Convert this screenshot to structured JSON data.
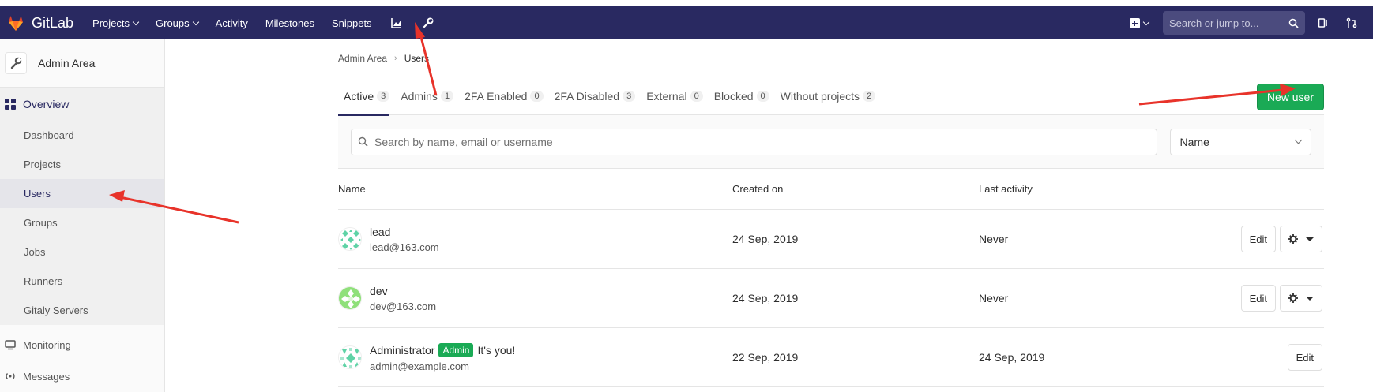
{
  "navbar": {
    "brand": "GitLab",
    "links": [
      {
        "label": "Projects",
        "dropdown": true
      },
      {
        "label": "Groups",
        "dropdown": true
      },
      {
        "label": "Activity",
        "dropdown": false
      },
      {
        "label": "Milestones",
        "dropdown": false
      },
      {
        "label": "Snippets",
        "dropdown": false
      }
    ],
    "search_placeholder": "Search or jump to...",
    "bg_color": "#292961"
  },
  "sidebar": {
    "title": "Admin Area",
    "overview_label": "Overview",
    "items": [
      {
        "label": "Dashboard",
        "active": false
      },
      {
        "label": "Projects",
        "active": false
      },
      {
        "label": "Users",
        "active": true
      },
      {
        "label": "Groups",
        "active": false
      },
      {
        "label": "Jobs",
        "active": false
      },
      {
        "label": "Runners",
        "active": false
      },
      {
        "label": "Gitaly Servers",
        "active": false
      }
    ],
    "monitoring_label": "Monitoring",
    "messages_label": "Messages"
  },
  "breadcrumb": {
    "parent": "Admin Area",
    "current": "Users"
  },
  "tabs": [
    {
      "label": "Active",
      "count": "3",
      "active": true
    },
    {
      "label": "Admins",
      "count": "1",
      "active": false
    },
    {
      "label": "2FA Enabled",
      "count": "0",
      "active": false
    },
    {
      "label": "2FA Disabled",
      "count": "3",
      "active": false
    },
    {
      "label": "External",
      "count": "0",
      "active": false
    },
    {
      "label": "Blocked",
      "count": "0",
      "active": false
    },
    {
      "label": "Without projects",
      "count": "2",
      "active": false
    }
  ],
  "new_user_label": "New user",
  "filter": {
    "search_placeholder": "Search by name, email or username",
    "sort_value": "Name"
  },
  "table": {
    "headers": {
      "name": "Name",
      "created": "Created on",
      "last": "Last activity"
    },
    "rows": [
      {
        "name": "lead",
        "email": "lead@163.com",
        "created": "24 Sep, 2019",
        "last": "Never",
        "edit": "Edit",
        "is_admin": false
      },
      {
        "name": "dev",
        "email": "dev@163.com",
        "created": "24 Sep, 2019",
        "last": "Never",
        "edit": "Edit",
        "is_admin": false
      },
      {
        "name": "Administrator",
        "badge": "Admin",
        "note": "It's you!",
        "email": "admin@example.com",
        "created": "22 Sep, 2019",
        "last": "24 Sep, 2019",
        "edit": "Edit",
        "is_admin": true
      }
    ]
  },
  "colors": {
    "accent": "#292961",
    "success": "#1aaa55",
    "annotation": "#e8332a"
  }
}
